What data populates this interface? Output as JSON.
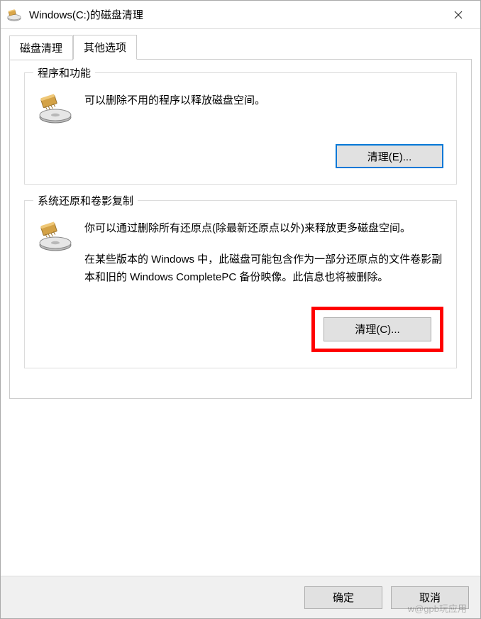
{
  "window": {
    "title": "Windows(C:)的磁盘清理"
  },
  "tabs": {
    "disk_cleanup": "磁盘清理",
    "more_options": "其他选项"
  },
  "programs_group": {
    "title": "程序和功能",
    "description": "可以删除不用的程序以释放磁盘空间。",
    "button_label": "清理(E)..."
  },
  "restore_group": {
    "title": "系统还原和卷影复制",
    "paragraph1": "你可以通过删除所有还原点(除最新还原点以外)来释放更多磁盘空间。",
    "paragraph2": "在某些版本的 Windows 中，此磁盘可能包含作为一部分还原点的文件卷影副本和旧的 Windows CompletePC 备份映像。此信息也将被删除。",
    "button_label": "清理(C)..."
  },
  "footer": {
    "ok": "确定",
    "cancel": "取消"
  },
  "watermark": "w@gpb玩应用"
}
